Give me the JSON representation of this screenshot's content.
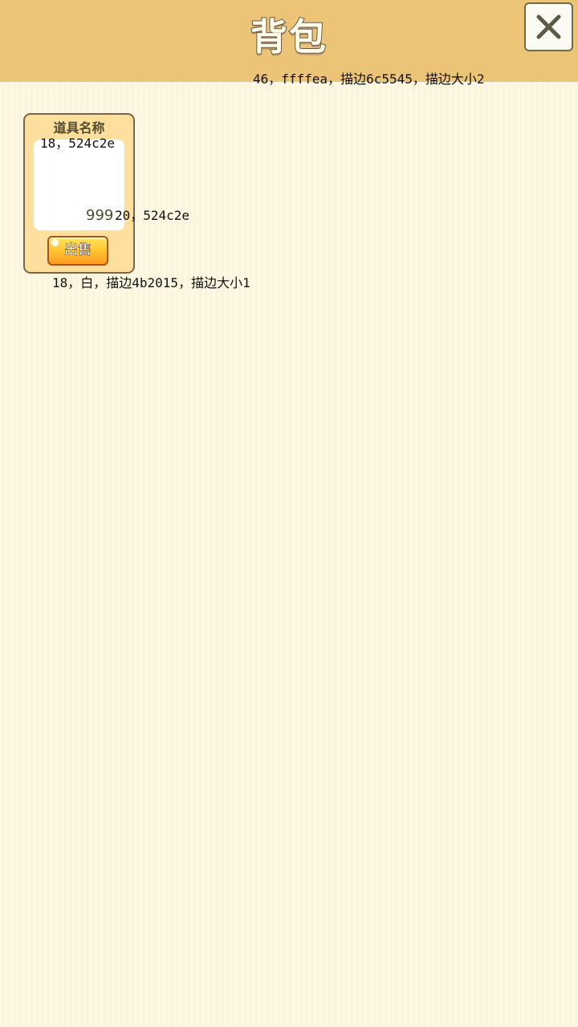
{
  "header": {
    "title": "背包",
    "title_note": "46，ffffea，描边6c5545，描边大小2"
  },
  "colors": {
    "header_bg": "#ecc477",
    "page_bg": "#fdf6e0",
    "title_fill": "#fffeea",
    "title_stroke": "#6c5545",
    "item_text": "#524c2e",
    "sell_stroke": "#4b2015"
  },
  "close_button": {
    "icon": "close-icon"
  },
  "inventory": {
    "items": [
      {
        "name": "道具名称",
        "name_note": "18，524c2e",
        "count": "999",
        "count_note": "20，524c2e",
        "sell_label": "出售",
        "sell_note": "18，白，描边4b2015，描边大小1"
      }
    ]
  }
}
